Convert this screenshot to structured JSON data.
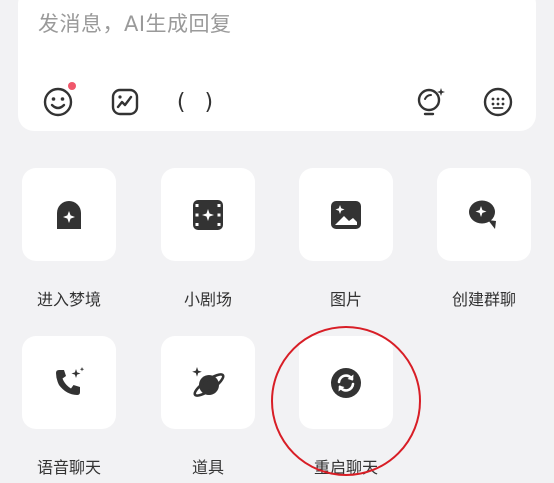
{
  "composer": {
    "placeholder": "发消息，AI生成回复",
    "tools": {
      "emoji": "smile-icon",
      "sticker": "sticker-icon",
      "parens": "( )",
      "inspiration": "lightbulb-icon",
      "keyboard": "keyboard-icon"
    },
    "emoji_badge_color": "#f0576b"
  },
  "actions": [
    {
      "label": "进入梦境",
      "icon": "dream-icon"
    },
    {
      "label": "小剧场",
      "icon": "film-icon"
    },
    {
      "label": "图片",
      "icon": "image-icon"
    },
    {
      "label": "创建群聊",
      "icon": "group-chat-icon"
    },
    {
      "label": "语音聊天",
      "icon": "phone-icon"
    },
    {
      "label": "道具",
      "icon": "planet-icon"
    },
    {
      "label": "重启聊天",
      "icon": "restart-icon"
    }
  ],
  "annotation_color": "#d81e26"
}
